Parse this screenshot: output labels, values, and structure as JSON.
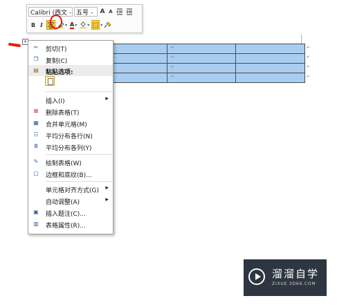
{
  "toolbar": {
    "font_name": "Calibri (西文 -",
    "font_size": "五号 -",
    "grow_font": "A",
    "shrink_font": "A",
    "bold": "B",
    "italic": "I",
    "font_color_letter": "A",
    "highlight_color": "#f4cf3a",
    "annotation_circle_color": "#e0180c"
  },
  "table": {
    "cell_marker": "↵",
    "rows": 4,
    "columns": 4,
    "selection_color": "#a9cdef"
  },
  "context_menu": {
    "cut": "剪切(T)",
    "copy": "复制(C)",
    "paste_options": "粘贴选项:",
    "insert": "插入(I)",
    "delete_table": "删除表格(T)",
    "merge_cells": "合并单元格(M)",
    "distribute_rows": "平均分布各行(N)",
    "distribute_columns": "平均分布各列(Y)",
    "draw_table": "绘制表格(W)",
    "borders_shading": "边框和底纹(B)...",
    "cell_alignment": "单元格对齐方式(G)",
    "autofit": "自动调整(A)",
    "insert_caption": "插入题注(C)...",
    "table_properties": "表格属性(R)..."
  },
  "watermark": {
    "title": "溜溜自学",
    "url": "ZIXUE.3D66.COM"
  }
}
